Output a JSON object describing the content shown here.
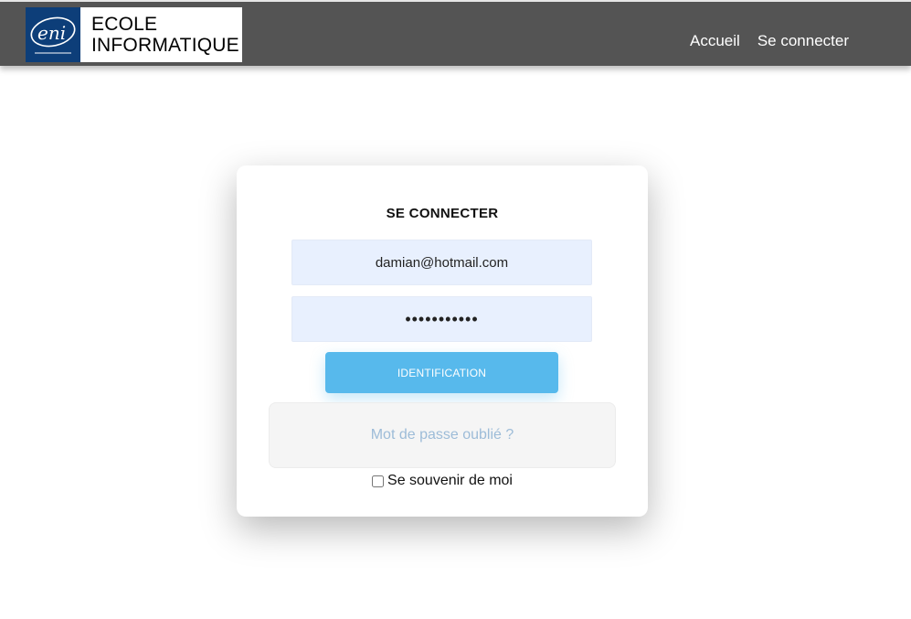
{
  "header": {
    "brand_logo_text": "eni",
    "brand_line1": "ECOLE",
    "brand_line2": "INFORMATIQUE",
    "nav": [
      {
        "label": "Accueil"
      },
      {
        "label": "Se connecter"
      }
    ]
  },
  "login": {
    "title": "SE CONNECTER",
    "email_value": "damian@hotmail.com",
    "password_value": "•••••••••••",
    "submit_label": "IDENTIFICATION",
    "forgot_label": "Mot de passe oublié ?",
    "remember_label": "Se souvenir de moi",
    "remember_checked": false
  },
  "colors": {
    "navbar": "#545454",
    "brand_blue": "#0d3e79",
    "button": "#57b9ec",
    "input_bg": "#e8f0fe",
    "forgot_text": "#9dbcd8"
  }
}
